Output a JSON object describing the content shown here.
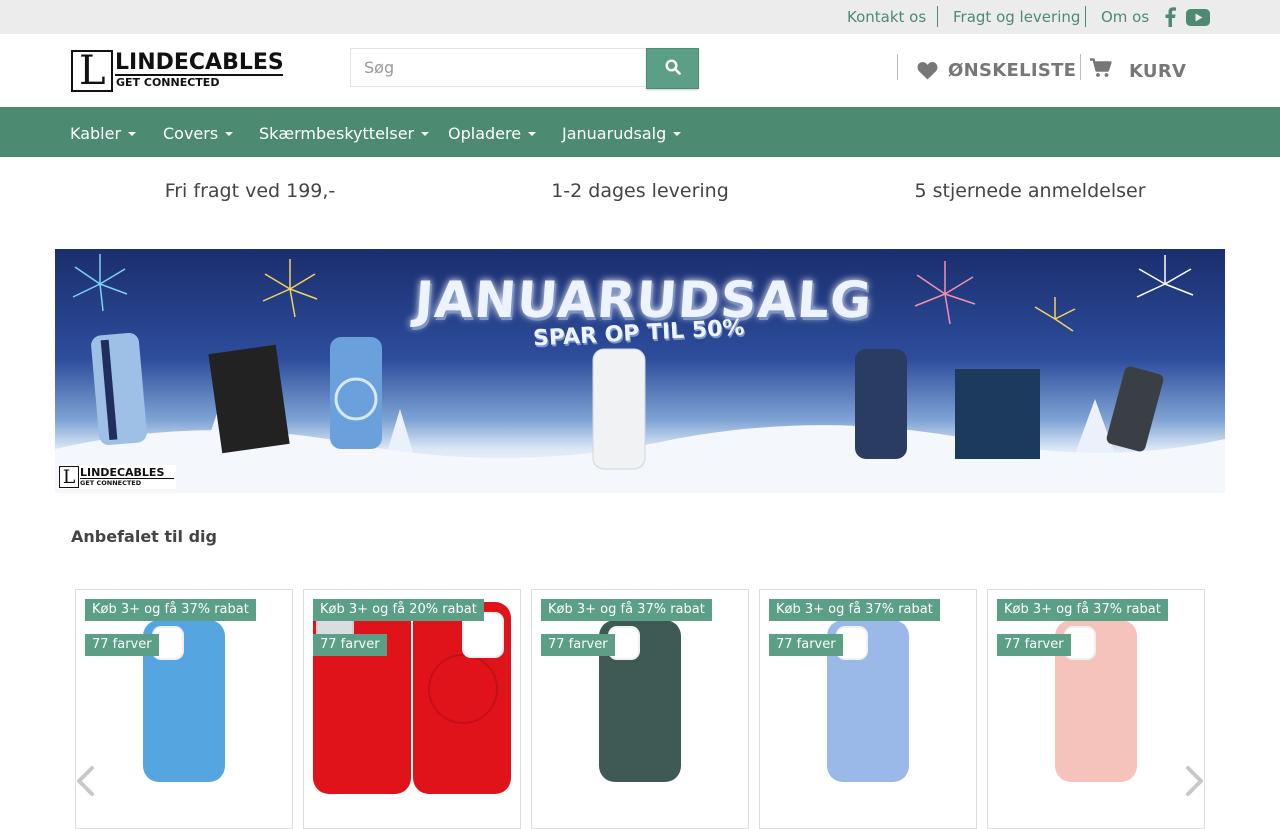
{
  "topbar": {
    "links": [
      "Kontakt os",
      "Fragt og levering",
      "Om os"
    ]
  },
  "header": {
    "logo_brand": "LINDECABLES",
    "logo_tagline": "GET CONNECTED",
    "logo_letter": "L",
    "search_placeholder": "Søg",
    "wishlist_label": "ØNSKELISTE",
    "cart_label": "KURV"
  },
  "nav": {
    "items": [
      "Kabler",
      "Covers",
      "Skærmbeskyttelser",
      "Opladere",
      "Januarudsalg"
    ]
  },
  "usp": [
    "Fri fragt ved 199,-",
    "1-2 dages levering",
    "5 stjernede anmeldelser"
  ],
  "banner": {
    "headline": "JANUARUDSALG",
    "subline": "SPAR OP TIL 50%"
  },
  "recommended": {
    "title": "Anbefalet til dig",
    "products": [
      {
        "badge_discount": "Køb 3+ og få 37% rabat",
        "badge_colors": "77 farver",
        "case_color": "#55a6e0"
      },
      {
        "badge_discount": "Køb 3+ og få 20% rabat",
        "badge_colors": "77 farver",
        "case_color": "#e0131b"
      },
      {
        "badge_discount": "Køb 3+ og få 37% rabat",
        "badge_colors": "77 farver",
        "case_color": "#3f5a55"
      },
      {
        "badge_discount": "Køb 3+ og få 37% rabat",
        "badge_colors": "77 farver",
        "case_color": "#9ab8e8"
      },
      {
        "badge_discount": "Køb 3+ og få 37% rabat",
        "badge_colors": "77 farver",
        "case_color": "#f5c3bc"
      }
    ]
  },
  "colors": {
    "accent": "#4d8a72",
    "button": "#5b9f87",
    "topbar_bg": "#ececec"
  },
  "icons": [
    "facebook-icon",
    "youtube-icon",
    "search-icon",
    "heart-icon",
    "cart-icon",
    "chevron-left-icon",
    "chevron-right-icon"
  ]
}
